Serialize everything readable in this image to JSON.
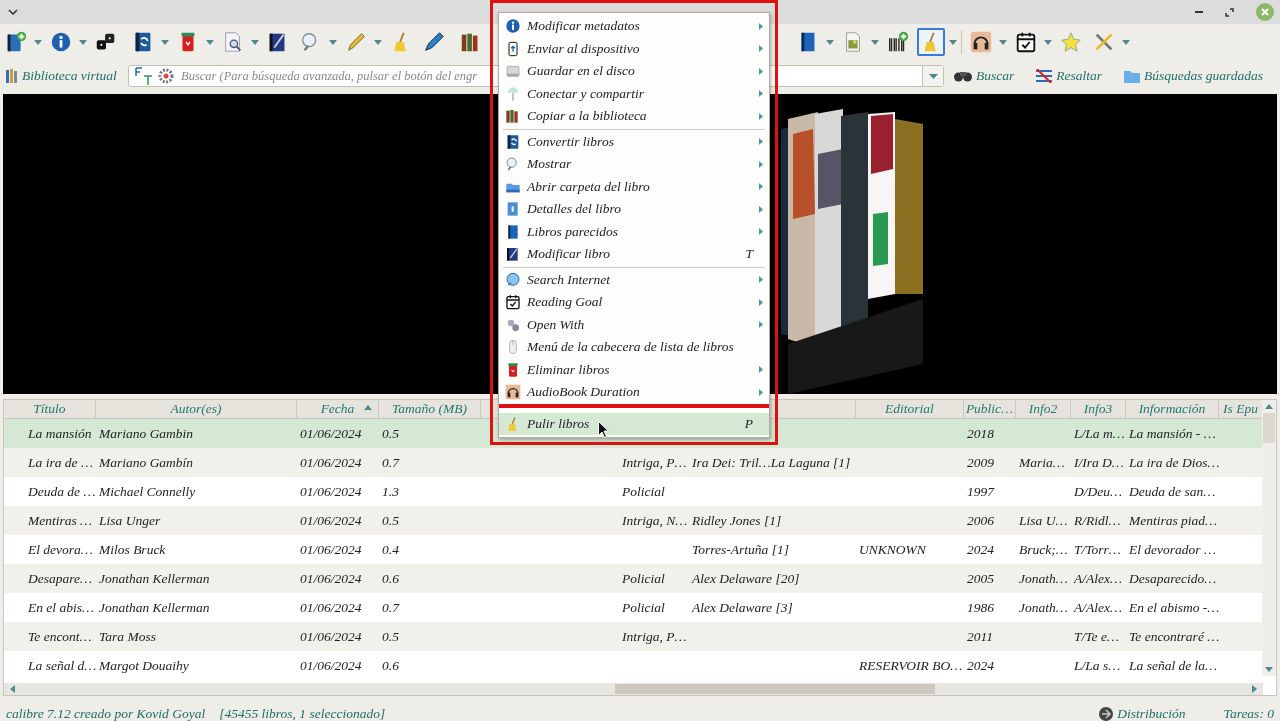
{
  "toolbar": {
    "items": [
      {
        "kind": "button",
        "dropdown": true,
        "selected": false
      },
      {
        "kind": "button",
        "dropdown": true,
        "selected": false
      },
      {
        "kind": "button",
        "dropdown": false,
        "selected": false
      },
      {
        "kind": "separator"
      },
      {
        "kind": "button",
        "dropdown": true,
        "selected": false
      },
      {
        "kind": "button",
        "dropdown": true,
        "selected": false
      },
      {
        "kind": "button",
        "dropdown": true,
        "selected": false
      },
      {
        "kind": "button",
        "dropdown": false,
        "selected": false
      },
      {
        "kind": "button",
        "dropdown": true,
        "selected": false
      },
      {
        "kind": "button",
        "dropdown": true,
        "selected": false
      },
      {
        "kind": "button",
        "dropdown": false,
        "selected": false
      },
      {
        "kind": "button",
        "dropdown": false,
        "selected": false
      },
      {
        "kind": "separator"
      },
      {
        "kind": "button",
        "dropdown": false,
        "selected": false
      }
    ],
    "items_right": [
      {
        "kind": "button",
        "dropdown": true,
        "selected": false
      },
      {
        "kind": "button",
        "dropdown": true,
        "selected": false
      },
      {
        "kind": "button",
        "dropdown": false,
        "selected": false
      },
      {
        "kind": "button",
        "dropdown": true,
        "selected": true
      },
      {
        "kind": "separator"
      },
      {
        "kind": "button",
        "dropdown": true,
        "selected": false
      },
      {
        "kind": "button",
        "dropdown": true,
        "selected": false
      },
      {
        "kind": "button",
        "dropdown": false,
        "selected": false
      },
      {
        "kind": "button",
        "dropdown": true,
        "selected": false
      }
    ]
  },
  "search_bar": {
    "virtual_library": "Biblioteca virtual",
    "search": {
      "placeholder": "Buscar (Para búsqueda avanzada, pulsar el botón del engr"
    },
    "search_button": "Buscar",
    "highlight_button": "Resaltar",
    "saved_searches": "Búsquedas guardadas"
  },
  "context_menu": {
    "items": [
      {
        "kind": "item",
        "label": "Modificar metadatos",
        "submenu": true,
        "selected": false
      },
      {
        "kind": "item",
        "label": "Enviar al dispositivo",
        "submenu": true,
        "selected": false
      },
      {
        "kind": "item",
        "label": "Guardar en el disco",
        "submenu": true,
        "selected": false
      },
      {
        "kind": "item",
        "label": "Conectar y compartir",
        "submenu": true,
        "selected": false
      },
      {
        "kind": "item",
        "label": "Copiar a la biblioteca",
        "submenu": true,
        "selected": false
      },
      {
        "kind": "separator"
      },
      {
        "kind": "item",
        "label": "Convertir libros",
        "submenu": true,
        "selected": false
      },
      {
        "kind": "item",
        "label": "Mostrar",
        "submenu": true,
        "selected": false
      },
      {
        "kind": "item",
        "label": "Abrir carpeta del libro",
        "submenu": true,
        "selected": false
      },
      {
        "kind": "item",
        "label": "Detalles del libro",
        "submenu": true,
        "selected": false
      },
      {
        "kind": "item",
        "label": "Libros parecidos",
        "submenu": true,
        "selected": false
      },
      {
        "kind": "item",
        "label": "Modificar libro",
        "submenu": false,
        "shortcut": "T",
        "selected": false
      },
      {
        "kind": "separator"
      },
      {
        "kind": "item",
        "label": "Search Internet",
        "submenu": true,
        "selected": false
      },
      {
        "kind": "item",
        "label": "Reading Goal",
        "submenu": true,
        "selected": false
      },
      {
        "kind": "item",
        "label": "Open With",
        "submenu": true,
        "selected": false
      },
      {
        "kind": "item",
        "label": "Menú de la cabecera de lista de libros",
        "submenu": false,
        "selected": false
      },
      {
        "kind": "item",
        "label": "Eliminar libros",
        "submenu": true,
        "selected": false
      },
      {
        "kind": "item",
        "label": "AudioBook Duration",
        "submenu": true,
        "selected": false
      },
      {
        "kind": "separator"
      },
      {
        "kind": "item",
        "label": "Pulir libros",
        "submenu": false,
        "shortcut": "P",
        "selected": true
      }
    ]
  },
  "table": {
    "columns": [
      {
        "label": "Título",
        "sorted": false
      },
      {
        "label": "Autor(es)",
        "sorted": false
      },
      {
        "label": "Fecha",
        "sorted": true
      },
      {
        "label": "Tamaño (MB)",
        "sorted": false
      },
      {},
      {},
      {},
      {
        "label": "Editorial",
        "sorted": false
      },
      {
        "label": "Public…",
        "sorted": false
      },
      {
        "label": "Info2",
        "sorted": false
      },
      {
        "label": "Info3",
        "sorted": false
      },
      {
        "label": "Información",
        "sorted": false
      },
      {
        "label": "Is Epu",
        "sorted": false
      }
    ],
    "rows": [
      {
        "selected": true,
        "title": "La mansión",
        "authors": "Mariano Gambin",
        "date": "01/06/2024",
        "size": "0.5",
        "published": "2018",
        "info3": "L/La m…",
        "information": "La mansión - …"
      },
      {
        "selected": false,
        "title": "La ira de …",
        "authors": "Mariano Gambín",
        "date": "01/06/2024",
        "size": "0.7",
        "column_6": "Intriga, P…",
        "column_7": "Ira Dei: Tril…La Laguna [1]",
        "published": "2009",
        "info2": "Maria…",
        "info3": "I/Ira D…",
        "information": "La ira de Dios…"
      },
      {
        "selected": false,
        "title": "Deuda de …",
        "authors": "Michael Connelly",
        "date": "01/06/2024",
        "size": "1.3",
        "column_6": "Policial",
        "published": "1997",
        "info3": "D/Deu…",
        "information": "Deuda de san…"
      },
      {
        "selected": false,
        "title": "Mentiras …",
        "authors": "Lisa Unger",
        "date": "01/06/2024",
        "size": "0.5",
        "column_6": "Intriga, N…",
        "column_7": "Ridley Jones [1]",
        "published": "2006",
        "info2": "Lisa U…",
        "info3": "R/Ridl…",
        "information": "Mentiras piad…"
      },
      {
        "selected": false,
        "title": "El devora…",
        "authors": "Milos Bruck",
        "date": "01/06/2024",
        "size": "0.4",
        "column_7": "Torres-Artuña [1]",
        "editorial": "UNKNOWN",
        "published": "2024",
        "info2": "Bruck;…",
        "info3": "T/Torr…",
        "information": "El devorador …"
      },
      {
        "selected": false,
        "title": "Desapare…",
        "authors": "Jonathan Kellerman",
        "date": "01/06/2024",
        "size": "0.6",
        "column_6": "Policial",
        "column_7": "Alex Delaware [20]",
        "published": "2005",
        "info2": "Jonath…",
        "info3": "A/Alex…",
        "information": "Desaparecido…"
      },
      {
        "selected": false,
        "title": "En el abis…",
        "authors": "Jonathan Kellerman",
        "date": "01/06/2024",
        "size": "0.7",
        "column_6": "Policial",
        "column_7": "Alex Delaware [3]",
        "published": "1986",
        "info2": "Jonath…",
        "info3": "A/Alex…",
        "information": "En el abismo -…"
      },
      {
        "selected": false,
        "title": "Te encont…",
        "authors": "Tara Moss",
        "date": "01/06/2024",
        "size": "0.5",
        "column_6": "Intriga, P…",
        "published": "2011",
        "info3": "T/Te e…",
        "information": "Te encontraré …"
      },
      {
        "selected": false,
        "title": "La señal d…",
        "authors": "Margot Douaihy",
        "date": "01/06/2024",
        "size": "0.6",
        "editorial": "RESERVOIR BO…",
        "published": "2024",
        "info3": "L/La s…",
        "information": "La señal de la…"
      }
    ]
  },
  "status_bar": {
    "version": "calibre 7.12 creado por Kovid Goyal",
    "count": "[45455 libros, 1 seleccionado]",
    "layout": "Distribución",
    "jobs": "Tareas: 0"
  }
}
